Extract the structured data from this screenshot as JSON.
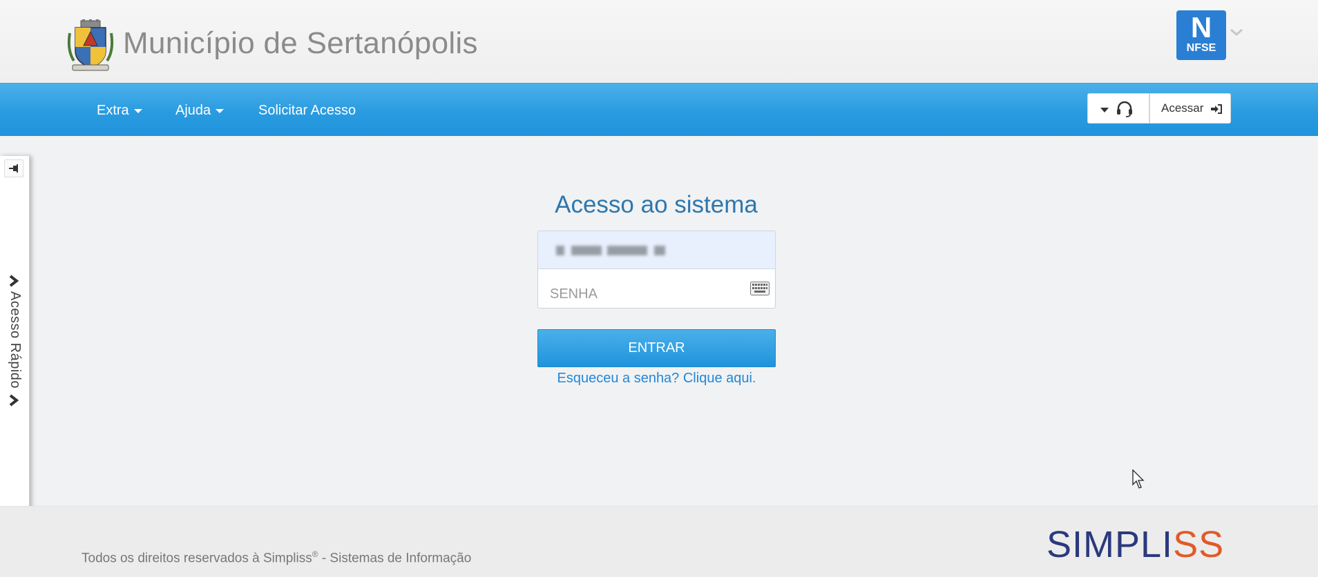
{
  "header": {
    "title": "Município de Sertanópolis",
    "badge_letter": "N",
    "badge_text": "NFSE"
  },
  "navbar": {
    "items": [
      {
        "label": "Extra",
        "has_dropdown": true
      },
      {
        "label": "Ajuda",
        "has_dropdown": true
      },
      {
        "label": "Solicitar Acesso",
        "has_dropdown": false
      }
    ],
    "login_label": "Acessar"
  },
  "side_panel": {
    "label": "Acesso Rápido"
  },
  "login": {
    "title": "Acesso ao sistema",
    "password_placeholder": "SENHA",
    "submit_label": "ENTRAR",
    "forgot_label": "Esqueceu a senha? Clique aqui."
  },
  "footer": {
    "copyright_prefix": "Todos os direitos reservados à Simpliss",
    "registered_mark": "®",
    "copyright_suffix": " - Sistemas de Informação",
    "logo_part1": "SIMPLI",
    "logo_part2": "SS"
  },
  "colors": {
    "nav_blue": "#2a9be0",
    "title_blue": "#2e77ad",
    "link_blue": "#2288d8",
    "badge_blue": "#2a7fd4",
    "logo_navy": "#2b3a7d",
    "logo_orange": "#e05a2a"
  },
  "icons": [
    "crest-icon",
    "chevron-down-icon",
    "headset-icon",
    "sign-in-icon",
    "pin-icon",
    "chevron-right-icon",
    "keyboard-icon",
    "mouse-cursor-icon"
  ]
}
